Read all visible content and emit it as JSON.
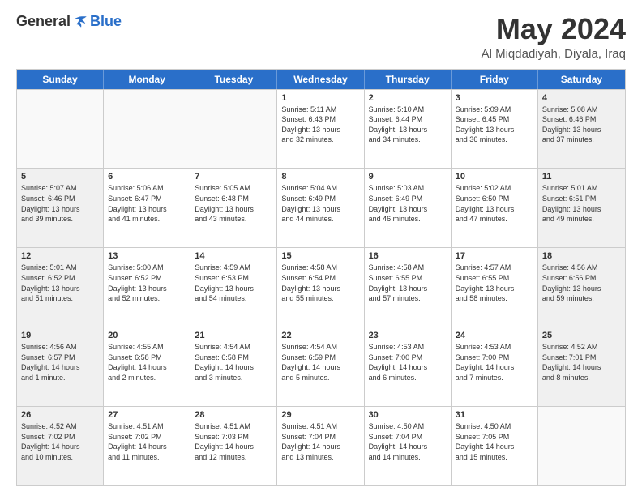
{
  "header": {
    "logo_general": "General",
    "logo_blue": "Blue",
    "month_title": "May 2024",
    "subtitle": "Al Miqdadiyah, Diyala, Iraq"
  },
  "days_of_week": [
    "Sunday",
    "Monday",
    "Tuesday",
    "Wednesday",
    "Thursday",
    "Friday",
    "Saturday"
  ],
  "rows": [
    [
      {
        "day": "",
        "text": "",
        "empty": true
      },
      {
        "day": "",
        "text": "",
        "empty": true
      },
      {
        "day": "",
        "text": "",
        "empty": true
      },
      {
        "day": "1",
        "text": "Sunrise: 5:11 AM\nSunset: 6:43 PM\nDaylight: 13 hours\nand 32 minutes."
      },
      {
        "day": "2",
        "text": "Sunrise: 5:10 AM\nSunset: 6:44 PM\nDaylight: 13 hours\nand 34 minutes."
      },
      {
        "day": "3",
        "text": "Sunrise: 5:09 AM\nSunset: 6:45 PM\nDaylight: 13 hours\nand 36 minutes."
      },
      {
        "day": "4",
        "text": "Sunrise: 5:08 AM\nSunset: 6:46 PM\nDaylight: 13 hours\nand 37 minutes.",
        "shaded": true
      }
    ],
    [
      {
        "day": "5",
        "text": "Sunrise: 5:07 AM\nSunset: 6:46 PM\nDaylight: 13 hours\nand 39 minutes.",
        "shaded": true
      },
      {
        "day": "6",
        "text": "Sunrise: 5:06 AM\nSunset: 6:47 PM\nDaylight: 13 hours\nand 41 minutes."
      },
      {
        "day": "7",
        "text": "Sunrise: 5:05 AM\nSunset: 6:48 PM\nDaylight: 13 hours\nand 43 minutes."
      },
      {
        "day": "8",
        "text": "Sunrise: 5:04 AM\nSunset: 6:49 PM\nDaylight: 13 hours\nand 44 minutes."
      },
      {
        "day": "9",
        "text": "Sunrise: 5:03 AM\nSunset: 6:49 PM\nDaylight: 13 hours\nand 46 minutes."
      },
      {
        "day": "10",
        "text": "Sunrise: 5:02 AM\nSunset: 6:50 PM\nDaylight: 13 hours\nand 47 minutes."
      },
      {
        "day": "11",
        "text": "Sunrise: 5:01 AM\nSunset: 6:51 PM\nDaylight: 13 hours\nand 49 minutes.",
        "shaded": true
      }
    ],
    [
      {
        "day": "12",
        "text": "Sunrise: 5:01 AM\nSunset: 6:52 PM\nDaylight: 13 hours\nand 51 minutes.",
        "shaded": true
      },
      {
        "day": "13",
        "text": "Sunrise: 5:00 AM\nSunset: 6:52 PM\nDaylight: 13 hours\nand 52 minutes."
      },
      {
        "day": "14",
        "text": "Sunrise: 4:59 AM\nSunset: 6:53 PM\nDaylight: 13 hours\nand 54 minutes."
      },
      {
        "day": "15",
        "text": "Sunrise: 4:58 AM\nSunset: 6:54 PM\nDaylight: 13 hours\nand 55 minutes."
      },
      {
        "day": "16",
        "text": "Sunrise: 4:58 AM\nSunset: 6:55 PM\nDaylight: 13 hours\nand 57 minutes."
      },
      {
        "day": "17",
        "text": "Sunrise: 4:57 AM\nSunset: 6:55 PM\nDaylight: 13 hours\nand 58 minutes."
      },
      {
        "day": "18",
        "text": "Sunrise: 4:56 AM\nSunset: 6:56 PM\nDaylight: 13 hours\nand 59 minutes.",
        "shaded": true
      }
    ],
    [
      {
        "day": "19",
        "text": "Sunrise: 4:56 AM\nSunset: 6:57 PM\nDaylight: 14 hours\nand 1 minute.",
        "shaded": true
      },
      {
        "day": "20",
        "text": "Sunrise: 4:55 AM\nSunset: 6:58 PM\nDaylight: 14 hours\nand 2 minutes."
      },
      {
        "day": "21",
        "text": "Sunrise: 4:54 AM\nSunset: 6:58 PM\nDaylight: 14 hours\nand 3 minutes."
      },
      {
        "day": "22",
        "text": "Sunrise: 4:54 AM\nSunset: 6:59 PM\nDaylight: 14 hours\nand 5 minutes."
      },
      {
        "day": "23",
        "text": "Sunrise: 4:53 AM\nSunset: 7:00 PM\nDaylight: 14 hours\nand 6 minutes."
      },
      {
        "day": "24",
        "text": "Sunrise: 4:53 AM\nSunset: 7:00 PM\nDaylight: 14 hours\nand 7 minutes."
      },
      {
        "day": "25",
        "text": "Sunrise: 4:52 AM\nSunset: 7:01 PM\nDaylight: 14 hours\nand 8 minutes.",
        "shaded": true
      }
    ],
    [
      {
        "day": "26",
        "text": "Sunrise: 4:52 AM\nSunset: 7:02 PM\nDaylight: 14 hours\nand 10 minutes.",
        "shaded": true
      },
      {
        "day": "27",
        "text": "Sunrise: 4:51 AM\nSunset: 7:02 PM\nDaylight: 14 hours\nand 11 minutes."
      },
      {
        "day": "28",
        "text": "Sunrise: 4:51 AM\nSunset: 7:03 PM\nDaylight: 14 hours\nand 12 minutes."
      },
      {
        "day": "29",
        "text": "Sunrise: 4:51 AM\nSunset: 7:04 PM\nDaylight: 14 hours\nand 13 minutes."
      },
      {
        "day": "30",
        "text": "Sunrise: 4:50 AM\nSunset: 7:04 PM\nDaylight: 14 hours\nand 14 minutes."
      },
      {
        "day": "31",
        "text": "Sunrise: 4:50 AM\nSunset: 7:05 PM\nDaylight: 14 hours\nand 15 minutes."
      },
      {
        "day": "",
        "text": "",
        "empty": true
      }
    ]
  ]
}
